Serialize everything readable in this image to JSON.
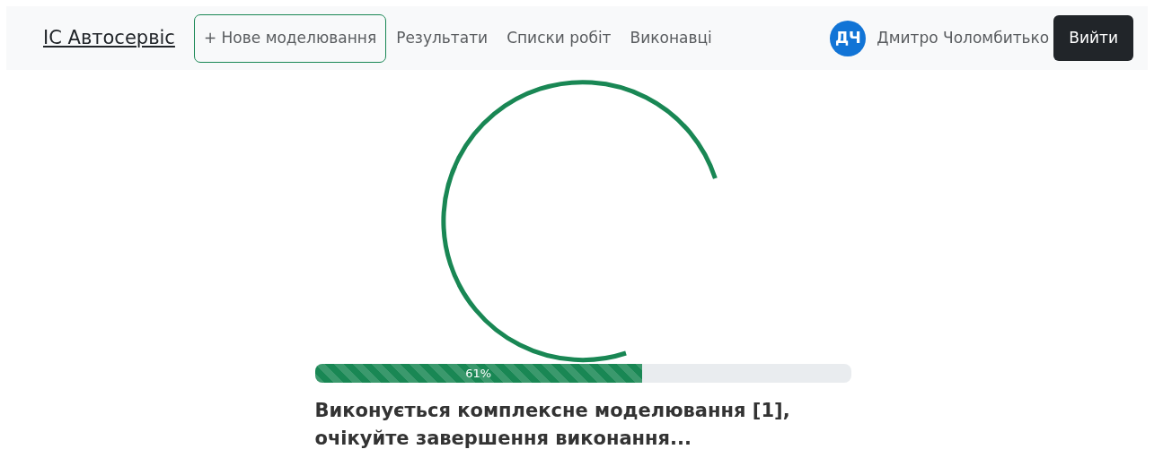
{
  "navbar": {
    "brand": "ІС Автосервіс",
    "new_button": "+ Нове моделювання",
    "links": [
      "Результати",
      "Списки робіт",
      "Виконавці"
    ],
    "user": {
      "initials": "ДЧ",
      "name": "Дмитро Чоломбитько"
    },
    "logout_button": "Вийти"
  },
  "progress": {
    "level": 0.61,
    "label": "61%",
    "striped": true
  },
  "message": "Виконується комплексне моделювання [1], очікуйте завершення виконання..."
}
